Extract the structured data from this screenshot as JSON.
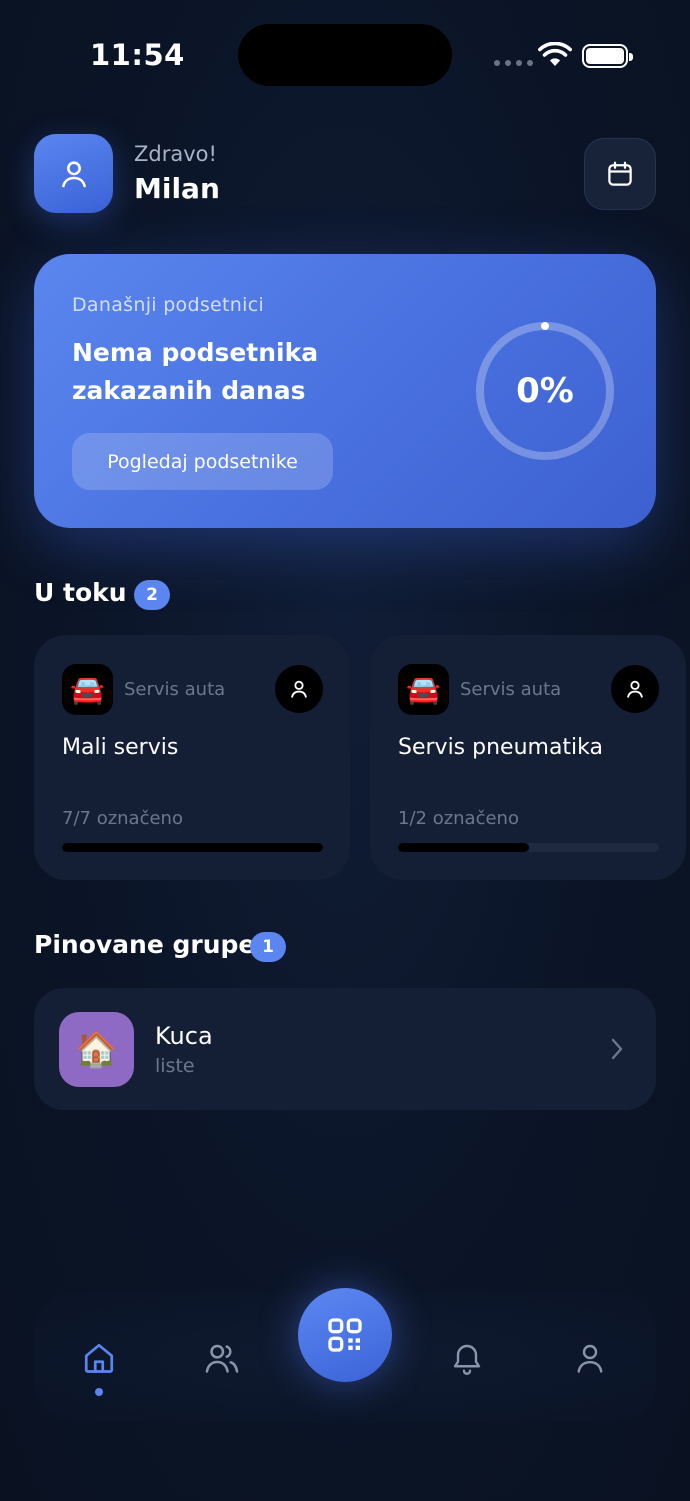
{
  "status_bar": {
    "time": "11:54"
  },
  "header": {
    "greeting": "Zdravo!",
    "username": "Milan"
  },
  "reminders": {
    "label": "Današnji podsetnici",
    "title": "Nema podsetnika zakazanih danas",
    "button_label": "Pogledaj podsetnike",
    "progress_text": "0%",
    "progress_value": 0
  },
  "in_progress": {
    "title": "U toku",
    "count": "2",
    "items": [
      {
        "emoji": "🚘",
        "category": "Servis auta",
        "name": "Mali servis",
        "progress_text": "7/7 označeno",
        "progress": 1.0
      },
      {
        "emoji": "🚘",
        "category": "Servis auta",
        "name": "Servis pneumatika",
        "progress_text": "1/2 označeno",
        "progress": 0.5
      }
    ]
  },
  "pinned": {
    "title": "Pinovane grupe",
    "count": "1",
    "items": [
      {
        "emoji": "🏠",
        "name": "Kuca",
        "subtitle": "liste"
      }
    ]
  },
  "colors": {
    "accent": "#5b86f0",
    "background": "#0b1426",
    "card": "#141f35",
    "group_icon_bg": "#8e6ac4"
  },
  "nav": {
    "items": [
      "home-icon",
      "groups-icon",
      "qr-icon",
      "bell-icon",
      "profile-icon"
    ],
    "active": "home-icon"
  }
}
